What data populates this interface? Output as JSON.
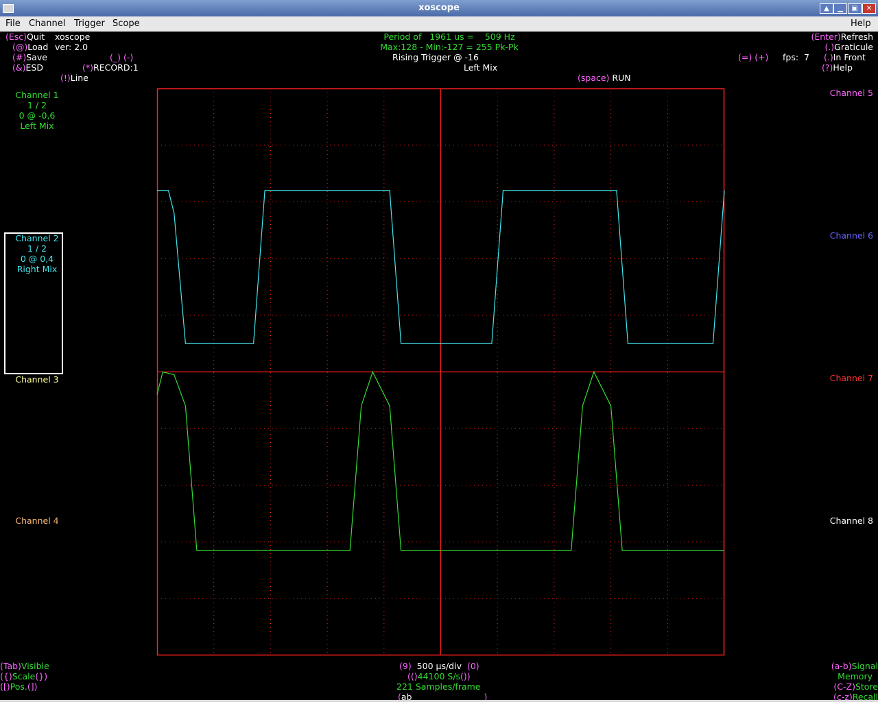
{
  "window": {
    "title": "xoscope"
  },
  "menubar": {
    "items": [
      "File",
      "Channel",
      "Trigger",
      "Scope"
    ],
    "help": "Help"
  },
  "top_left": {
    "quit_key": "(Esc)",
    "quit_label": "Quit",
    "app_name": "xoscope",
    "load_key": "(@)",
    "load_label": "Load",
    "version": "ver: 2.0",
    "save_key": "(#)",
    "save_label": "Save",
    "esd_key": "(&)",
    "esd_label": "ESD",
    "record_key": "(*)",
    "record_label": "RECORD:1",
    "line_key": "(!)",
    "line_label": "Line",
    "dash_keys": "(_) (-)"
  },
  "top_center": {
    "period": "Period of   1961 us =    509 Hz",
    "maxmin": "Max:128 - Min:-127 = 255 Pk-Pk",
    "trigger": "Rising Trigger @ -16",
    "trigger_channel": "Left Mix",
    "run_key": "(space)",
    "run_label": "RUN"
  },
  "top_right": {
    "refresh_key": "(Enter)",
    "refresh_label": "Refresh",
    "graticule_key": "(.)",
    "graticule_label": "Graticule",
    "infront_key": "(.)",
    "infront_label": "In Front",
    "help_key": "(?)",
    "help_label": "Help",
    "fps_keys": "(=) (+)",
    "fps": "fps:  7"
  },
  "channels_left": [
    {
      "name": "Channel 1",
      "scale": "1 / 2",
      "pos": "0 @ -0,6",
      "source": "Left Mix",
      "color": "#33dd33"
    },
    {
      "name": "Channel 2",
      "scale": "1 / 2",
      "pos": "0 @ 0,4",
      "source": "Right Mix",
      "color": "#44e6ee",
      "selected": true
    },
    {
      "name": "Channel 3",
      "color": "#ffff99"
    },
    {
      "name": "Channel 4",
      "color": "#ffbb77"
    }
  ],
  "channels_right": [
    {
      "name": "Channel 5",
      "color": "#ff66ff"
    },
    {
      "name": "Channel 6",
      "color": "#6666ff"
    },
    {
      "name": "Channel 7",
      "color": "#ff3030"
    },
    {
      "name": "Channel 8",
      "color": "#ffffff"
    }
  ],
  "bottom_left": {
    "visible_key": "(Tab)",
    "visible_label": "Visible",
    "scale_key_l": "({)",
    "scale_label": "Scale",
    "scale_key_r": "(})",
    "pos_key_l": "([)",
    "pos_label": "Pos.",
    "pos_key_r": "(])"
  },
  "bottom_center": {
    "timebase_key_l": "(9)",
    "timebase": "500 µs/div",
    "timebase_key_r": "(0)",
    "rate_key_l": "(()",
    "rate": "44100 S/s",
    "rate_key_r": "())",
    "samples": "221 Samples/frame",
    "mode_key_l": "(",
    "mode": "ab",
    "mode_key_r": ")"
  },
  "bottom_right": {
    "signal_key": "(a-b)",
    "signal_label": "Signal",
    "memory_label": "Memory",
    "store_key": "(C-Z)",
    "store_label": "Store",
    "recall_key": "(c-z)",
    "recall_label": "Recall"
  },
  "colors": {
    "graticule": "#ff2020",
    "ch1": "#33dd33",
    "ch2": "#44e6ee",
    "key": "#ff66ff"
  },
  "chart_data": {
    "type": "line",
    "x_divisions": 10,
    "y_divisions": 10,
    "grid": "dotted",
    "series": [
      {
        "name": "Channel 1",
        "color": "#33dd33",
        "x": [
          0,
          0.1,
          0.3,
          0.5,
          0.7,
          3.4,
          3.6,
          3.8,
          4.1,
          4.3,
          7.3,
          7.5,
          7.7,
          8.0,
          8.2,
          10.0
        ],
        "y": [
          -0.4,
          0.0,
          -0.05,
          -0.6,
          -3.15,
          -3.15,
          -0.6,
          0.0,
          -0.6,
          -3.15,
          -3.15,
          -0.6,
          0.0,
          -0.6,
          -3.15,
          -3.15
        ]
      },
      {
        "name": "Channel 2",
        "color": "#44e6ee",
        "x": [
          0,
          0.2,
          0.3,
          0.5,
          1.7,
          1.9,
          4.1,
          4.3,
          5.9,
          6.1,
          8.1,
          8.3,
          9.8,
          10.0
        ],
        "y": [
          3.2,
          3.2,
          2.8,
          0.5,
          0.5,
          3.2,
          3.2,
          0.5,
          0.5,
          3.2,
          3.2,
          0.5,
          0.5,
          3.2
        ]
      }
    ]
  }
}
